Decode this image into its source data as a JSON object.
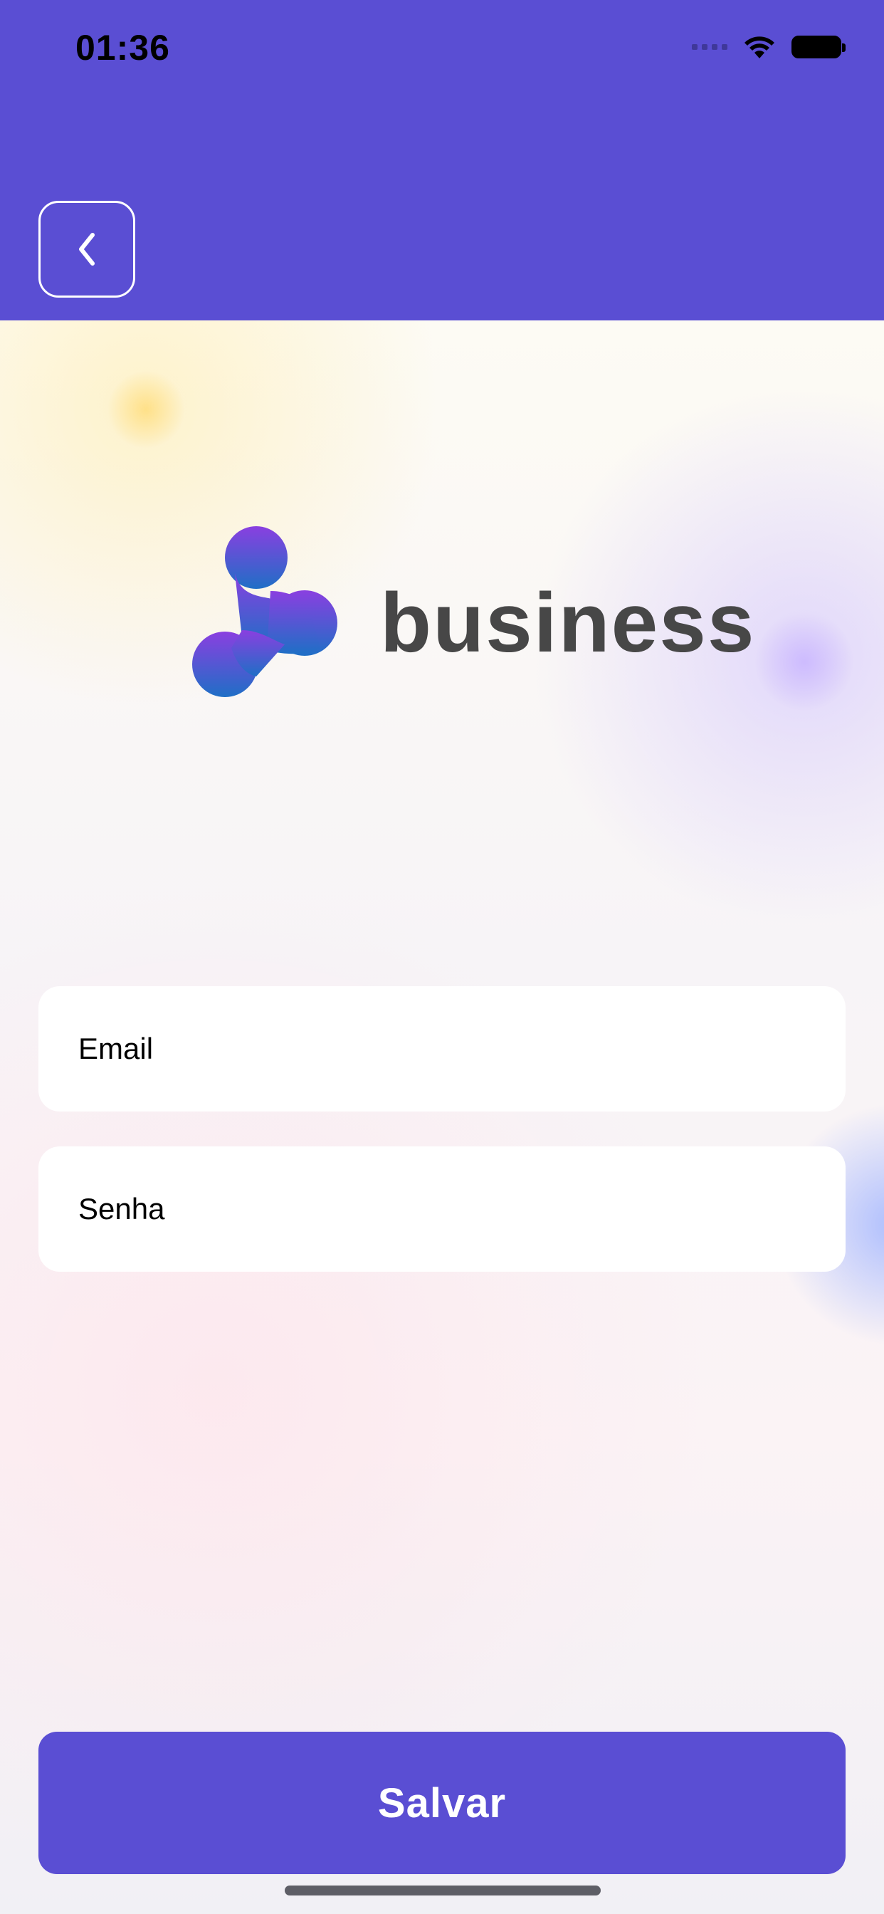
{
  "status_bar": {
    "time": "01:36"
  },
  "header": {
    "back_icon": "chevron-left-icon",
    "color": "#5a4ed3"
  },
  "logo": {
    "text": "business"
  },
  "form": {
    "email_placeholder": "Email",
    "password_placeholder": "Senha"
  },
  "actions": {
    "save_label": "Salvar"
  }
}
